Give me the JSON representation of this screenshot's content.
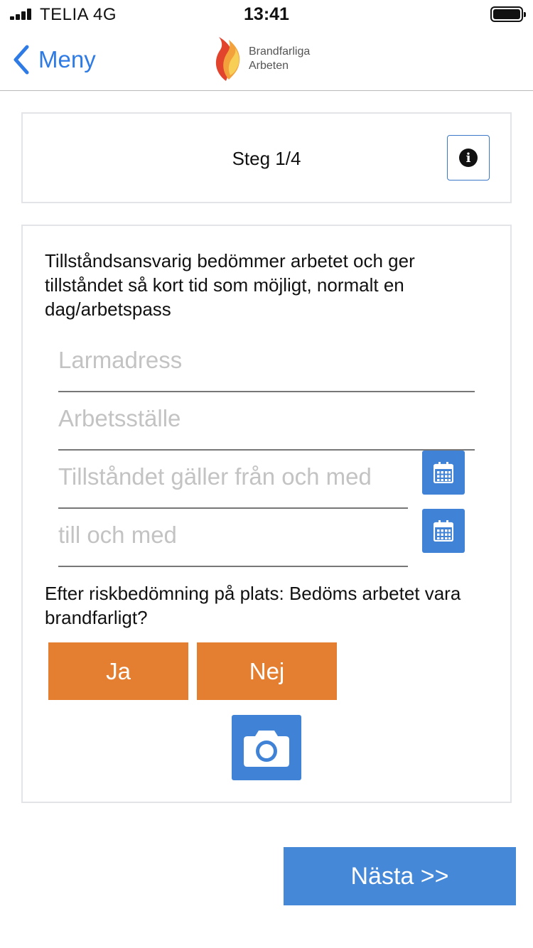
{
  "status_bar": {
    "carrier": "TELIA  4G",
    "time": "13:41"
  },
  "nav": {
    "back_label": "Meny",
    "logo_line1": "Brandfarliga",
    "logo_line2": "Arbeten"
  },
  "step": {
    "title": "Steg 1/4"
  },
  "form": {
    "intro": "Tillståndsansvarig bedömmer arbetet och ger tillståndet så kort tid som möjligt, normalt en dag/arbetspass",
    "fields": [
      {
        "placeholder": "Larmadress",
        "value": ""
      },
      {
        "placeholder": "Arbetsställe",
        "value": ""
      },
      {
        "placeholder": "Tillståndet gäller från och med",
        "value": ""
      },
      {
        "placeholder": "till och med",
        "value": ""
      }
    ],
    "question": "Efter riskbedömning på plats: Bedöms arbetet vara brandfarligt?",
    "yes_label": "Ja",
    "no_label": "Nej"
  },
  "footer": {
    "next_label": "Nästa >>"
  },
  "icons": {
    "back": "chevron-left-icon",
    "info": "info-icon",
    "calendar": "calendar-icon",
    "camera": "camera-icon"
  },
  "colors": {
    "accent_blue": "#4083d6",
    "ios_blue": "#2f7be5",
    "choice_orange": "#e47e31"
  }
}
